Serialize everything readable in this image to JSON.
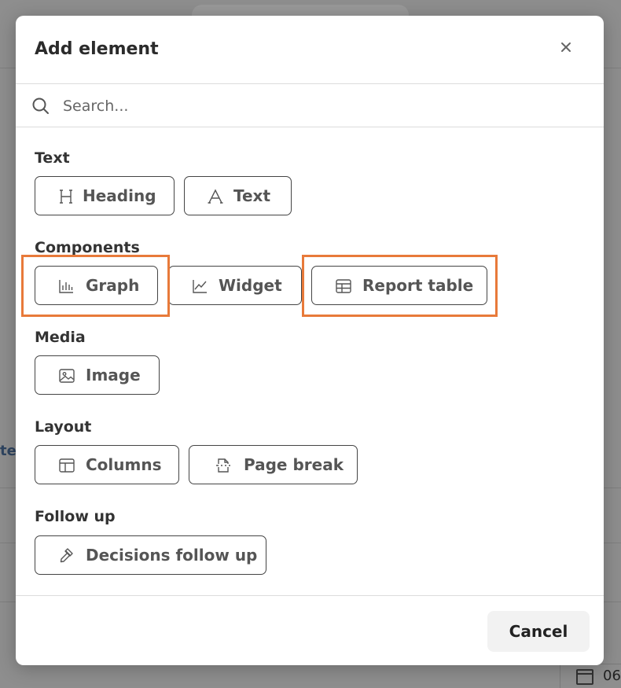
{
  "modal": {
    "title": "Add element",
    "close_label": "×"
  },
  "search": {
    "placeholder": "Search...",
    "value": ""
  },
  "sections": {
    "text": {
      "label": "Text",
      "items": [
        {
          "label": "Heading",
          "icon": "heading-icon"
        },
        {
          "label": "Text",
          "icon": "text-icon"
        }
      ]
    },
    "components": {
      "label": "Components",
      "items": [
        {
          "label": "Graph",
          "icon": "bar-chart-icon",
          "highlighted": true
        },
        {
          "label": "Widget",
          "icon": "line-chart-icon",
          "highlighted": false
        },
        {
          "label": "Report table",
          "icon": "table-icon",
          "highlighted": true
        }
      ]
    },
    "media": {
      "label": "Media",
      "items": [
        {
          "label": "Image",
          "icon": "image-icon"
        }
      ]
    },
    "layout": {
      "label": "Layout",
      "items": [
        {
          "label": "Columns",
          "icon": "columns-icon"
        },
        {
          "label": "Page break",
          "icon": "page-break-icon"
        }
      ]
    },
    "follow_up": {
      "label": "Follow up",
      "items": [
        {
          "label": "Decisions follow up",
          "icon": "gavel-icon"
        }
      ]
    }
  },
  "footer": {
    "cancel_label": "Cancel"
  },
  "background": {
    "left_text": "te",
    "date_text": "06"
  },
  "colors": {
    "highlight": "#e87a3a",
    "overlay": "#8e8e8e",
    "button_border": "#444444"
  }
}
